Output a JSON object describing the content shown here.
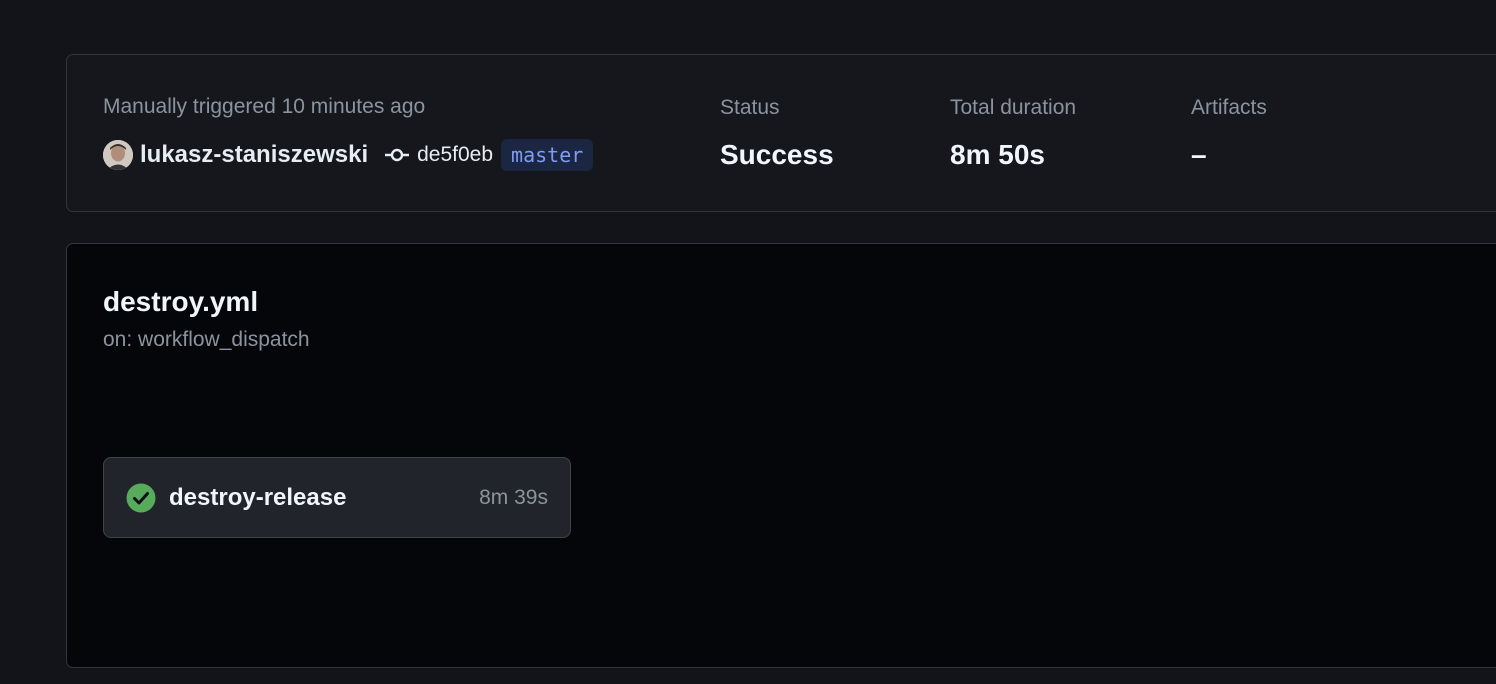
{
  "summary": {
    "trigger_text": "Manually triggered 10 minutes ago",
    "actor": "lukasz-staniszewski",
    "commit_sha": "de5f0eb",
    "branch": "master",
    "status_label": "Status",
    "status_value": "Success",
    "duration_label": "Total duration",
    "duration_value": "8m 50s",
    "artifacts_label": "Artifacts",
    "artifacts_value": "–"
  },
  "workflow": {
    "file_name": "destroy.yml",
    "trigger": "on: workflow_dispatch",
    "jobs": [
      {
        "name": "destroy-release",
        "duration": "8m 39s",
        "status": "success",
        "status_icon": "check-circle-icon"
      }
    ]
  },
  "colors": {
    "success": "#57ab5a",
    "branch_badge_bg": "#1b2642",
    "branch_badge_text": "#7f9cf5",
    "muted_text": "#8b949e"
  }
}
